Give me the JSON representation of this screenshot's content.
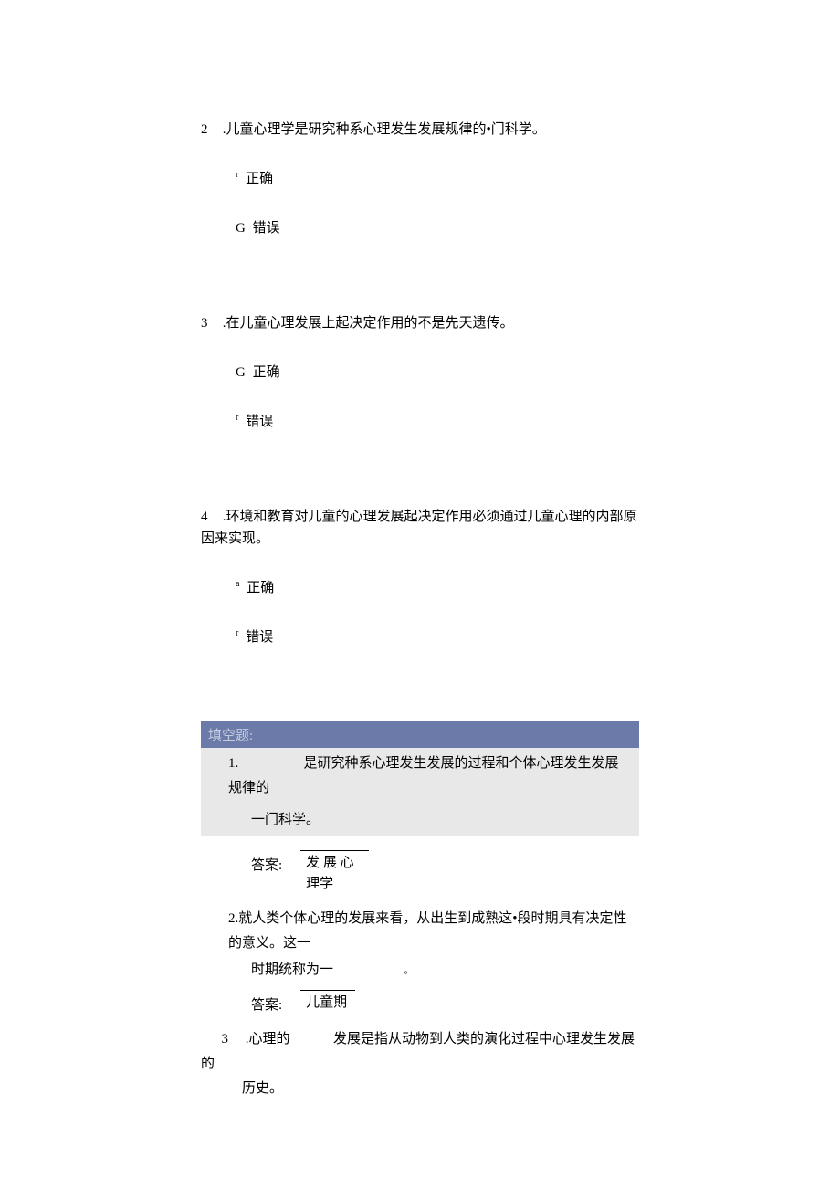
{
  "questions": {
    "q2": {
      "number": "2",
      "text": ".儿童心理学是研究种系心理发生发展规律的•门科学。",
      "opt_correct_prefix": "r",
      "opt_correct": "正确",
      "opt_wrong_prefix": "G",
      "opt_wrong": "错误"
    },
    "q3": {
      "number": "3",
      "text": ".在儿童心理发展上起决定作用的不是先天遗传。",
      "opt_correct_prefix": "G",
      "opt_correct": "正确",
      "opt_wrong_prefix": "r",
      "opt_wrong": "错误"
    },
    "q4": {
      "number": "4",
      "text": ".环境和教育对儿童的心理发展起决定作用必须通过儿童心理的内部原因来实现。",
      "opt_correct_prefix": "a",
      "opt_correct": "正确",
      "opt_wrong_prefix": "r",
      "opt_wrong": "错误"
    }
  },
  "section_header": "填空题:",
  "fill": {
    "f1": {
      "number": "1.",
      "line1": "是研究种系心理发生发展的过程和个体心理发生发展规律的",
      "line2": "一门科学。",
      "answer_label": "答案:",
      "answer": "发 展 心 理学"
    },
    "f2": {
      "line1": "2.就人类个体心理的发展来看，从出生到成熟这•段时期具有决定性的意义。这一",
      "line2_a": "时期统称为一",
      "line2_b": "。",
      "answer_label": "答案:",
      "answer": "儿童期"
    },
    "f3": {
      "number": "3",
      "line1_a": ".心理的",
      "line1_b": "发展是指从动物到人类的演化过程中心理发生发展的",
      "line2": "历史。"
    }
  }
}
